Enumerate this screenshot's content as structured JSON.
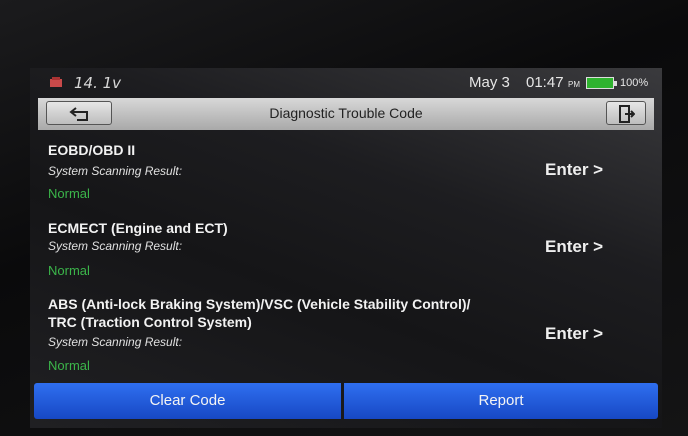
{
  "status": {
    "voltage": "14. 1v",
    "date": "May 3",
    "time": "01:47",
    "ampm": "PM",
    "battery": "100%"
  },
  "title_bar": {
    "title": "Diagnostic Trouble Code",
    "back_icon": "back-arrow-icon",
    "exit_icon": "exit-icon"
  },
  "systems": [
    {
      "name_lines": [
        "EOBD/OBD II"
      ],
      "scan_label": "System Scanning Result:",
      "scan_value": "Normal",
      "enter": "Enter >"
    },
    {
      "name_lines": [
        "ECMECT (Engine and ECT)"
      ],
      "scan_label": "System Scanning Result:",
      "scan_value": "Normal",
      "enter": "Enter >"
    },
    {
      "name_lines": [
        "ABS (Anti-lock Braking System)/VSC (Vehicle Stability Control)/",
        "TRC (Traction Control System)"
      ],
      "scan_label": "System Scanning Result:",
      "scan_value": "Normal",
      "enter": "Enter >"
    }
  ],
  "buttons": {
    "clear_code": "Clear Code",
    "report": "Report"
  },
  "colors": {
    "normal": "#3bb54a",
    "button_blue": "#1f5be0",
    "battery_green": "#2fb32f"
  }
}
